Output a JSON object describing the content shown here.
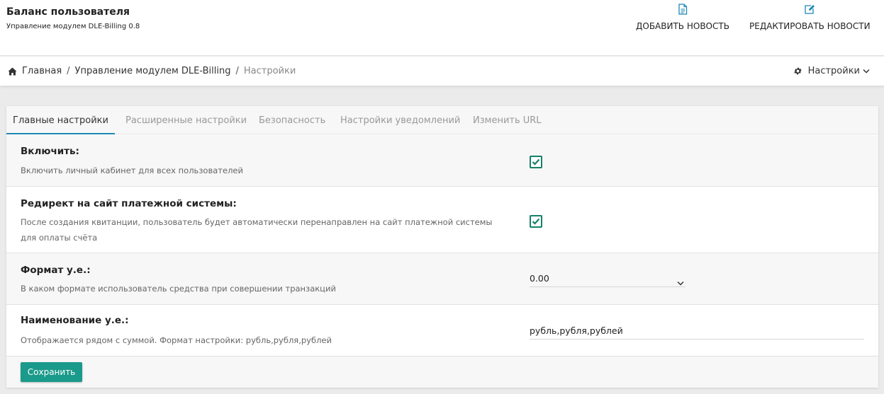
{
  "header": {
    "title": "Баланс пользователя",
    "subtitle": "Управление модулем DLE-Billing 0.8",
    "actions": [
      {
        "label": "ДОБАВИТЬ НОВОСТЬ",
        "icon": "file-text-icon"
      },
      {
        "label": "РЕДАКТИРОВАТЬ НОВОСТИ",
        "icon": "edit-icon"
      }
    ]
  },
  "breadcrumb": {
    "home_icon": "home-icon",
    "items": [
      "Главная",
      "Управление модулем DLE-Billing",
      "Настройки"
    ],
    "separator": "/"
  },
  "settings_menu": {
    "label": "Настройки",
    "icon": "gear-icon"
  },
  "tabs": [
    {
      "label": "Главные настройки",
      "active": true
    },
    {
      "label": "Расширенные настройки",
      "active": false
    },
    {
      "label": "Безопасность",
      "active": false
    },
    {
      "label": "Настройки уведомлений",
      "active": false
    },
    {
      "label": "Изменить URL",
      "active": false
    }
  ],
  "settings": [
    {
      "label": "Включить:",
      "description": "Включить личный кабинет для всех пользователей",
      "control": "checkbox",
      "checked": true
    },
    {
      "label": "Редирект на сайт платежной системы:",
      "description": "После создания квитанции, пользователь будет автоматически перенаправлен на сайт платежной системы для оплаты счёта",
      "control": "checkbox",
      "checked": true
    },
    {
      "label": "Формат у.е.:",
      "description": "В каком формате использователь средства при совершении транзакций",
      "control": "select",
      "value": "0.00"
    },
    {
      "label": "Наименование у.е.:",
      "description": "Отображается рядом с суммой. Формат настройки: рубль,рубля,рублей",
      "control": "text",
      "value": "рубль,рубля,рублей"
    }
  ],
  "footer": {
    "save_label": "Сохранить"
  },
  "colors": {
    "accent": "#1a9a8a",
    "checkbox": "#17806a",
    "tab_underline": "#1e88b5"
  }
}
